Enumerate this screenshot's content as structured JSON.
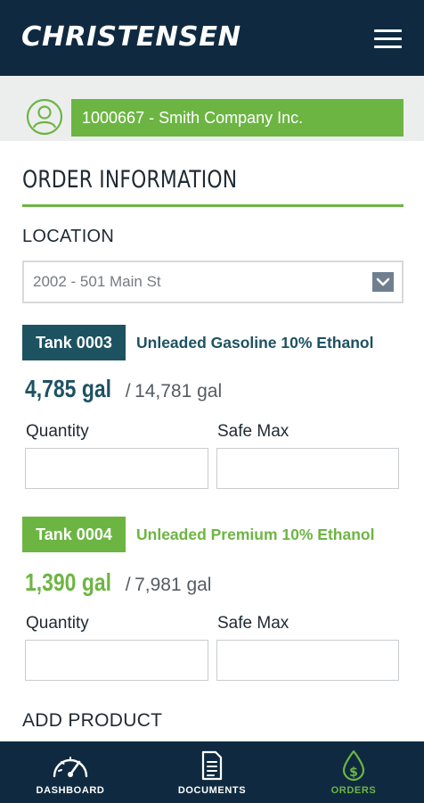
{
  "header": {
    "logo_text": "CHRISTENSEN",
    "menu_icon": "hamburger-menu-icon"
  },
  "customer": {
    "selected": "1000667 - Smith Company Inc.",
    "icon": "user-circle-icon"
  },
  "order": {
    "title": "ORDER INFORMATION",
    "location_label": "LOCATION",
    "location_value": "2002 - 501 Main St",
    "tanks": [
      {
        "badge": "Tank 0003",
        "product": "Unleaded Gasoline 10% Ethanol",
        "current": "4,785 gal",
        "separator": "/",
        "capacity": "14,781 gal",
        "accent": "#1d5261",
        "quantity_label": "Quantity",
        "safe_max_label": "Safe Max",
        "quantity_value": "",
        "safe_max_value": ""
      },
      {
        "badge": "Tank 0004",
        "product": "Unleaded Premium 10% Ethanol",
        "current": "1,390 gal",
        "separator": "/",
        "capacity": "7,981 gal",
        "accent": "#6db543",
        "quantity_label": "Quantity",
        "safe_max_label": "Safe Max",
        "quantity_value": "",
        "safe_max_value": ""
      }
    ],
    "add_product_label": "ADD PRODUCT"
  },
  "nav": {
    "items": [
      {
        "label": "DASHBOARD",
        "icon": "gauge-icon",
        "active": false
      },
      {
        "label": "DOCUMENTS",
        "icon": "document-icon",
        "active": false
      },
      {
        "label": "ORDERS",
        "icon": "dollar-drop-icon",
        "active": true
      }
    ],
    "active_color": "#6db543"
  },
  "colors": {
    "navy": "#0f2a40",
    "green": "#6db543",
    "teal": "#1d5261"
  }
}
